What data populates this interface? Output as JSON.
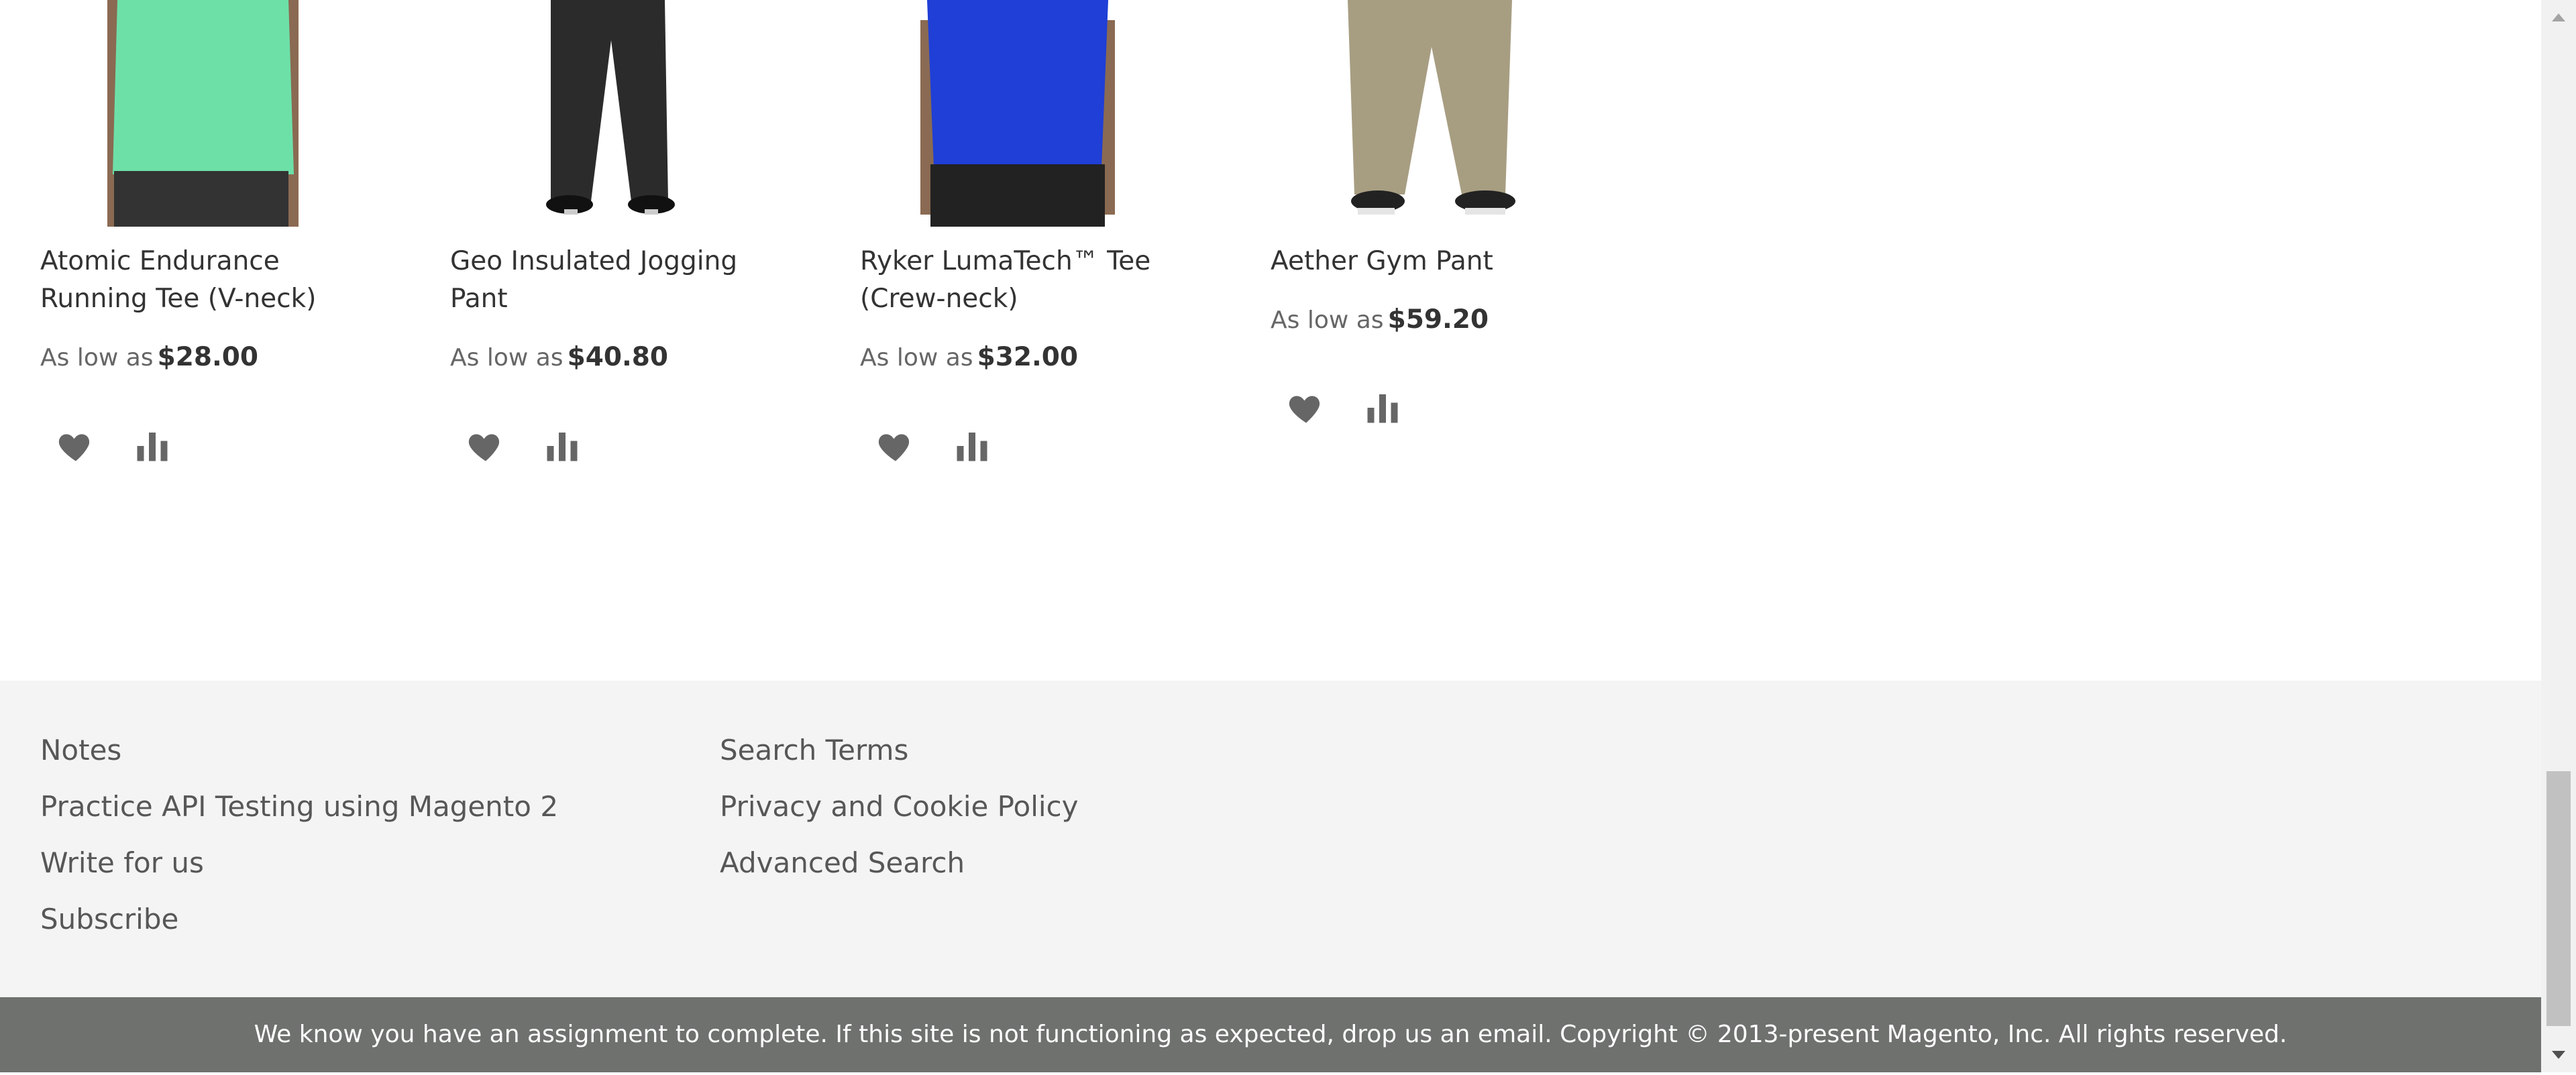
{
  "products": [
    {
      "name": "Atomic Endurance Running Tee (V-neck)",
      "price_label": "As low as",
      "price": "$28.00",
      "color": "#6de0a8"
    },
    {
      "name": "Geo Insulated Jogging Pant",
      "price_label": "As low as",
      "price": "$40.80",
      "color": "#2b2b2b"
    },
    {
      "name": "Ryker LumaTech™ Tee (Crew-neck)",
      "price_label": "As low as",
      "price": "$32.00",
      "color": "#1f3fd6"
    },
    {
      "name": "Aether Gym Pant",
      "price_label": "As low as",
      "price": "$59.20",
      "color": "#a79e82"
    }
  ],
  "footer": {
    "col1": [
      "Notes",
      "Practice API Testing using Magento 2",
      "Write for us",
      "Subscribe"
    ],
    "col2": [
      "Search Terms",
      "Privacy and Cookie Policy",
      "Advanced Search"
    ]
  },
  "copyright": "We know you have an assignment to complete. If this site is not functioning as expected, drop us an email. Copyright © 2013-present Magento, Inc. All rights reserved.",
  "icons": {
    "wishlist": "heart-icon",
    "compare": "bar-chart-icon"
  },
  "colors": {
    "footer_bg": "#f4f4f4",
    "copyright_bg": "#6e716e",
    "icon": "#666666"
  }
}
